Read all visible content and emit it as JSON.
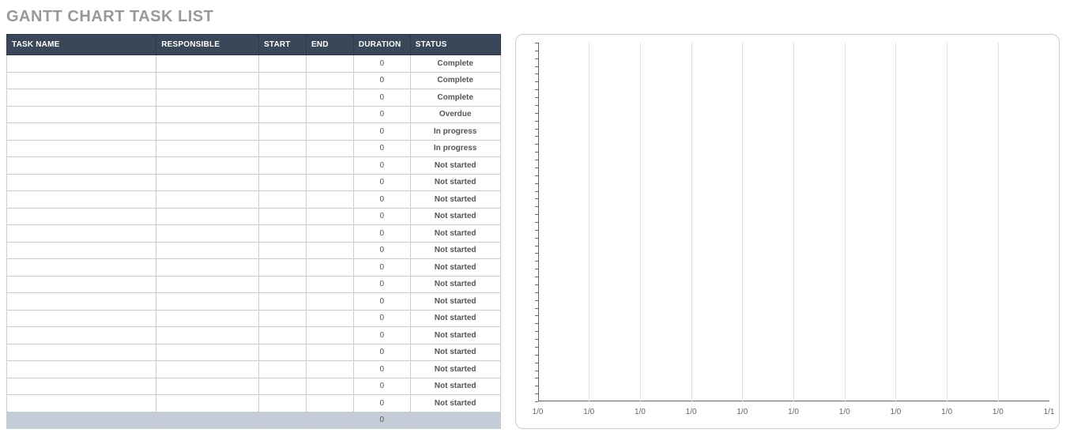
{
  "title": "GANTT CHART TASK LIST",
  "table": {
    "headers": {
      "task": "TASK NAME",
      "responsible": "RESPONSIBLE",
      "start": "START",
      "end": "END",
      "duration": "DURATION",
      "status": "STATUS"
    },
    "rows": [
      {
        "task": "",
        "responsible": "",
        "start": "",
        "end": "",
        "duration": "0",
        "status": "Complete",
        "status_class": "complete"
      },
      {
        "task": "",
        "responsible": "",
        "start": "",
        "end": "",
        "duration": "0",
        "status": "Complete",
        "status_class": "complete"
      },
      {
        "task": "",
        "responsible": "",
        "start": "",
        "end": "",
        "duration": "0",
        "status": "Complete",
        "status_class": "complete"
      },
      {
        "task": "",
        "responsible": "",
        "start": "",
        "end": "",
        "duration": "0",
        "status": "Overdue",
        "status_class": "overdue"
      },
      {
        "task": "",
        "responsible": "",
        "start": "",
        "end": "",
        "duration": "0",
        "status": "In progress",
        "status_class": "inprogress"
      },
      {
        "task": "",
        "responsible": "",
        "start": "",
        "end": "",
        "duration": "0",
        "status": "In progress",
        "status_class": "inprogress"
      },
      {
        "task": "",
        "responsible": "",
        "start": "",
        "end": "",
        "duration": "0",
        "status": "Not started",
        "status_class": "notstarted"
      },
      {
        "task": "",
        "responsible": "",
        "start": "",
        "end": "",
        "duration": "0",
        "status": "Not started",
        "status_class": "notstarted"
      },
      {
        "task": "",
        "responsible": "",
        "start": "",
        "end": "",
        "duration": "0",
        "status": "Not started",
        "status_class": "notstarted"
      },
      {
        "task": "",
        "responsible": "",
        "start": "",
        "end": "",
        "duration": "0",
        "status": "Not started",
        "status_class": "notstarted"
      },
      {
        "task": "",
        "responsible": "",
        "start": "",
        "end": "",
        "duration": "0",
        "status": "Not started",
        "status_class": "notstarted"
      },
      {
        "task": "",
        "responsible": "",
        "start": "",
        "end": "",
        "duration": "0",
        "status": "Not started",
        "status_class": "notstarted"
      },
      {
        "task": "",
        "responsible": "",
        "start": "",
        "end": "",
        "duration": "0",
        "status": "Not started",
        "status_class": "notstarted"
      },
      {
        "task": "",
        "responsible": "",
        "start": "",
        "end": "",
        "duration": "0",
        "status": "Not started",
        "status_class": "notstarted"
      },
      {
        "task": "",
        "responsible": "",
        "start": "",
        "end": "",
        "duration": "0",
        "status": "Not started",
        "status_class": "notstarted"
      },
      {
        "task": "",
        "responsible": "",
        "start": "",
        "end": "",
        "duration": "0",
        "status": "Not started",
        "status_class": "notstarted"
      },
      {
        "task": "",
        "responsible": "",
        "start": "",
        "end": "",
        "duration": "0",
        "status": "Not started",
        "status_class": "notstarted"
      },
      {
        "task": "",
        "responsible": "",
        "start": "",
        "end": "",
        "duration": "0",
        "status": "Not started",
        "status_class": "notstarted"
      },
      {
        "task": "",
        "responsible": "",
        "start": "",
        "end": "",
        "duration": "0",
        "status": "Not started",
        "status_class": "notstarted"
      },
      {
        "task": "",
        "responsible": "",
        "start": "",
        "end": "",
        "duration": "0",
        "status": "Not started",
        "status_class": "notstarted"
      },
      {
        "task": "",
        "responsible": "",
        "start": "",
        "end": "",
        "duration": "0",
        "status": "Not started",
        "status_class": "notstarted"
      }
    ],
    "footer": {
      "task": "",
      "responsible": "",
      "start": "",
      "end": "",
      "duration": "0",
      "status": ""
    }
  },
  "chart_data": {
    "type": "bar",
    "title": "",
    "xlabel": "",
    "ylabel": "",
    "x_ticks": [
      "1/0",
      "1/0",
      "1/0",
      "1/0",
      "1/0",
      "1/0",
      "1/0",
      "1/0",
      "1/0",
      "1/0",
      "1/1"
    ],
    "y_tick_count": 46,
    "series": [],
    "gridlines_vertical": true,
    "xlim": [
      0,
      10
    ]
  }
}
